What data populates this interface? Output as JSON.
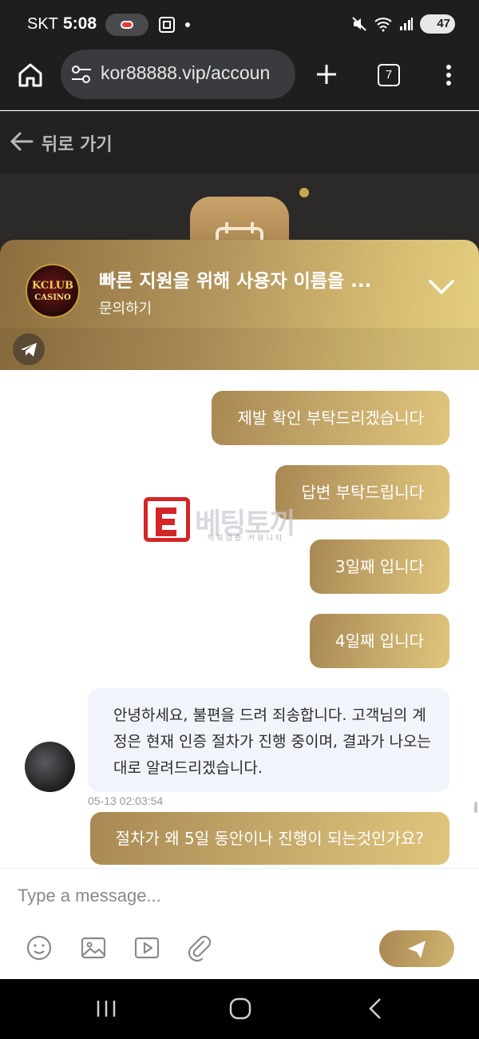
{
  "status_bar": {
    "carrier": "SKT",
    "time": "5:08",
    "battery": "47"
  },
  "browser": {
    "url": "kor88888.vip/accoun",
    "tab_count": "7"
  },
  "page": {
    "back_label": "뒤로 가기"
  },
  "chat": {
    "header_title": "빠른 지원을 위해 사용자 이름을 ...",
    "header_subtitle": "문의하기",
    "logo_text_1": "KCLUB",
    "logo_text_2": "CASINO",
    "messages_out": [
      "제발 확인 부탁드리겠습니다",
      "답변 부탁드립니다",
      "3일째 입니다",
      "4일째 입니다"
    ],
    "message_in": "안녕하세요, 불편을 드려 죄송합니다. 고객님의 계정은 현재 인증 절차가 진행 중이며, 결과가 나오는 대로 알려드리겠습니다.",
    "message_in_time": "05-13 02:03:54",
    "last_message_out": "절차가 왜 5일 동안이나 진행이 되는것인가요?",
    "input_placeholder": "Type a message..."
  },
  "watermark": {
    "text": "베팅토끼",
    "small": "먹튀검증 커뮤니티"
  },
  "colors": {
    "gold_dark": "#a98853",
    "gold_light": "#e0c57c",
    "browser_bg": "#1e1e1f",
    "incoming_bubble": "#f1f4fb"
  }
}
